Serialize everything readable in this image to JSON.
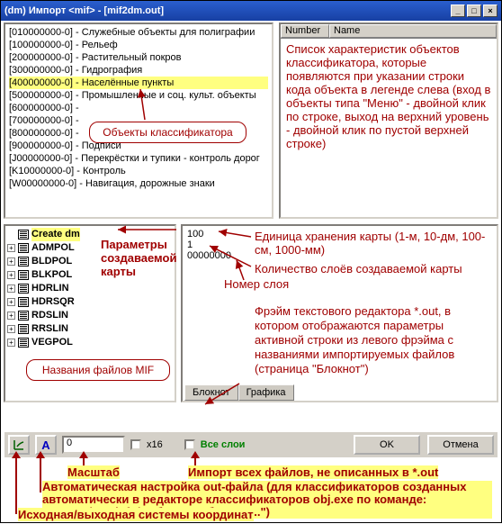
{
  "title": "(dm) Импорт <mif> - [mif2dm.out]",
  "wincontrols": {
    "min": "_",
    "max": "□",
    "close": "×"
  },
  "leftlist": {
    "rows": [
      "[010000000-0] - Служебные объекты для полиграфии",
      "[100000000-0] - Рельеф",
      "[200000000-0] - Растительный покров",
      "[300000000-0] - Гидрография",
      "[400000000-0] - Населённые пункты",
      "[500000000-0] - Промышленные и соц. культ. объекты",
      "[600000000-0] - ",
      "[700000000-0] - ",
      "[800000000-0] - ",
      "[900000000-0] - Подписи",
      "[J00000000-0] - Перекрёстки и тупики - контроль дорог",
      "[K10000000-0] - Контроль",
      "[W00000000-0] - Навигация, дорожные знаки"
    ]
  },
  "rightlist": {
    "cols": [
      "Number",
      "Name"
    ]
  },
  "description_right": "Список характеристик объектов классификатора, которые появляются при указании строки кода объекта в легенде слева (вход в объекты типа \"Меню\" - двойной клик по строке, выход на верхний уровень - двойной клик по пустой верхней строке)",
  "tree": {
    "root": "Create dm",
    "items": [
      "ADMPOL",
      "BLDPOL",
      "BLKPOL",
      "HDRLIN",
      "HDRSQR",
      "RDSLIN",
      "RRSLIN",
      "VEGPOL"
    ]
  },
  "rpanel": {
    "lines": [
      "100",
      "1",
      "00000000"
    ]
  },
  "tabs": {
    "a": "Блокнот",
    "b": "Графика"
  },
  "bottom": {
    "num": "0",
    "x16": "x16",
    "all_layers": "Все слои",
    "ok": "OK",
    "cancel": "Отмена"
  },
  "callouts": {
    "objclass": "Объекты классификатора",
    "params": "Параметры\nсоздаваемой\nкарты",
    "miffiles": "Названия файлов MIF",
    "unit": "Единица хранения карты (1-м, 10-дм, 100-см, 1000-мм)",
    "layers": "Количество слоёв создаваемой карты",
    "layernum": "Номер слоя",
    "frame": "Фрэйм текстового редактора *.out, в котором отображаются параметры активной строки из левого фрэйма с названиями импортируемых файлов (страница \"Блокнот\")"
  },
  "bottom_ann": {
    "a": "Масштаб",
    "b": "Импорт всех файлов, не описанных в *.out",
    "c": "Автоматическая настройка out-файла (для классификаторов созданных автоматически в редакторе классификаторов obj.exe по команде: \"Разное/Mapinfo/Добавить объекты...\")",
    "d": "Исходная/выходная системы координат"
  }
}
